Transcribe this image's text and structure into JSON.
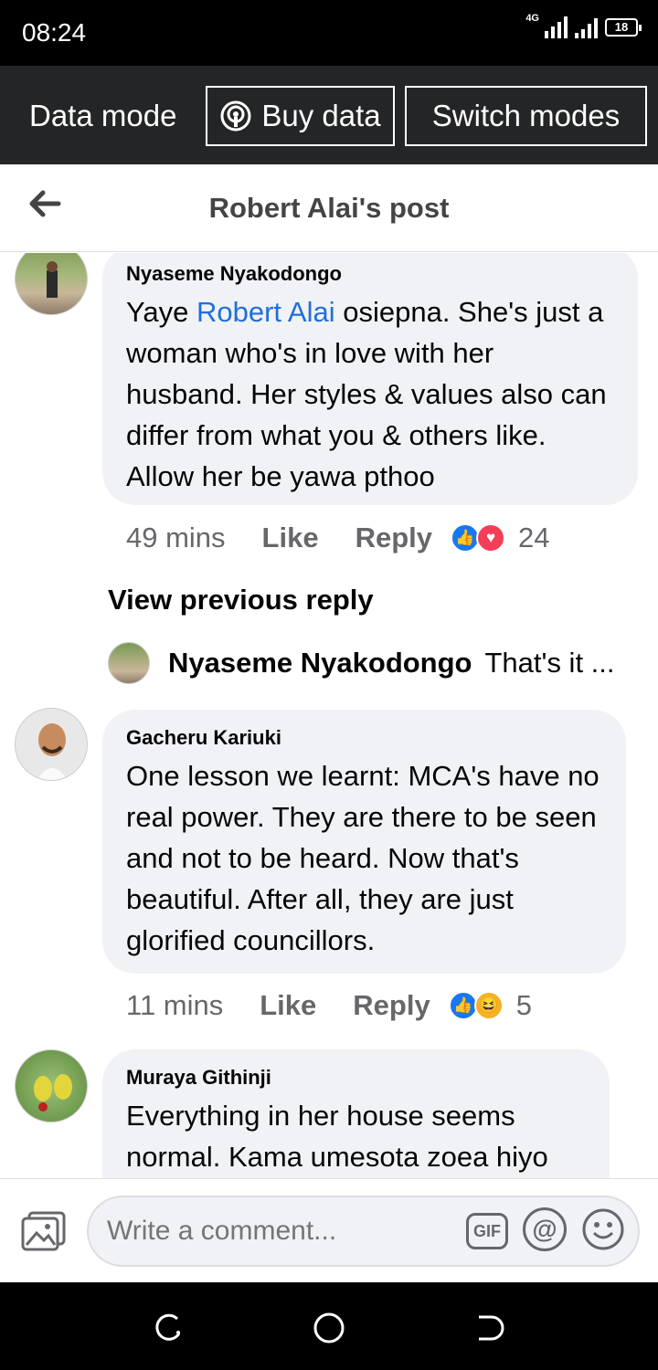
{
  "status": {
    "time": "08:24",
    "network": "4G",
    "battery": "18"
  },
  "data_bar": {
    "label": "Data mode",
    "buy": "Buy data",
    "switch": "Switch modes"
  },
  "header": {
    "title": "Robert Alai's post"
  },
  "comments": [
    {
      "author": "Nyaseme Nyakodongo",
      "text_before": "Yaye ",
      "mention": "Robert Alai",
      "text_after": " osiepna. She's just a woman who's in love with her husband. Her styles & values also can differ from what you & others like. Allow her be yawa pthoo",
      "time": "49 mins",
      "like": "Like",
      "reply": "Reply",
      "reactions": [
        "like-icon",
        "love-icon"
      ],
      "reaction_count": "24"
    },
    {
      "author": "Gacheru Kariuki",
      "text": "One lesson we learnt: MCA's have no real power. They are there to be seen and not to be heard. Now that's beautiful. After all, they are just glorified councillors.",
      "time": "11 mins",
      "like": "Like",
      "reply": "Reply",
      "reactions": [
        "like-icon",
        "haha-icon"
      ],
      "reaction_count": "5"
    },
    {
      "author": "Muraya Githinji",
      "text": "Everything in her house seems normal. Kama umesota zoea hiyo"
    }
  ],
  "view_previous": "View previous reply",
  "reply_preview": {
    "author": "Nyaseme Nyakodongo",
    "text": "That's it ..."
  },
  "composer": {
    "placeholder": "Write a comment...",
    "gif": "GIF",
    "at": "@"
  },
  "colors": {
    "status_bar": "#000000",
    "data_bar": "#242526",
    "bubble": "#f0f2f5",
    "mention": "#216fdb",
    "meta": "#65676b"
  }
}
